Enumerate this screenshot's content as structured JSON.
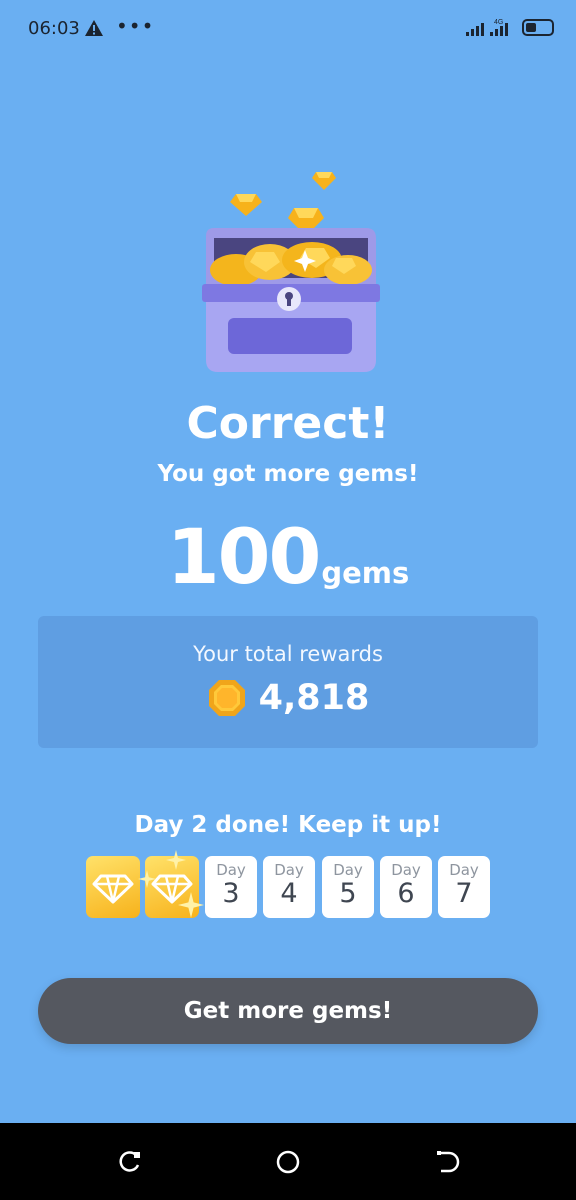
{
  "status_bar": {
    "time": "06:03",
    "overflow": "•••",
    "network": "4G",
    "icons": [
      "warning-icon",
      "signal-icon",
      "battery-icon"
    ]
  },
  "reward": {
    "title": "Correct!",
    "subtitle": "You got more gems!",
    "amount": "100",
    "unit": "gems"
  },
  "total_rewards": {
    "label": "Your total rewards",
    "value": "4,818"
  },
  "streak": {
    "message": "Day 2 done! Keep it up!",
    "completed_days": 2,
    "day_word": "Day",
    "upcoming_days": [
      "3",
      "4",
      "5",
      "6",
      "7"
    ]
  },
  "cta": {
    "label": "Get more gems!"
  },
  "nav": {
    "icons": [
      "recent-apps-icon",
      "home-icon",
      "back-icon"
    ]
  },
  "colors": {
    "background": "#6aaff2",
    "panel": "#5f9ee2",
    "button": "#555860",
    "gem": "#f7b21b",
    "chest": "#a8a6f2"
  }
}
